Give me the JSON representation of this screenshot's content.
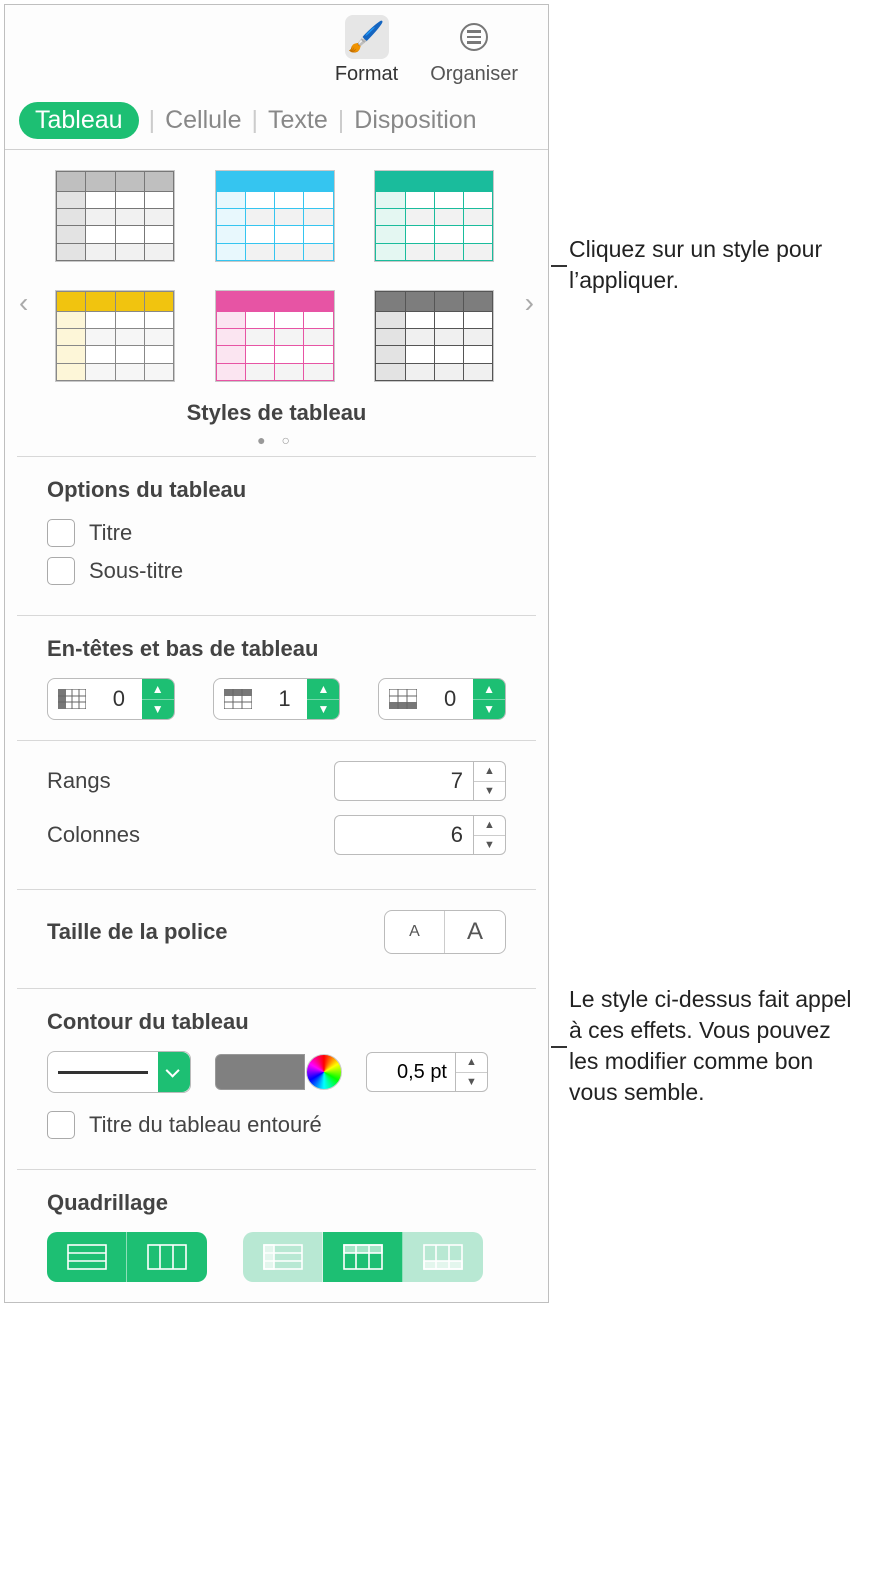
{
  "toolbar": {
    "format": "Format",
    "organize": "Organiser"
  },
  "tabs": {
    "tableau": "Tableau",
    "cellule": "Cellule",
    "texte": "Texte",
    "disposition": "Disposition"
  },
  "styles_title": "Styles de tableau",
  "options": {
    "title": "Options du tableau",
    "titre": "Titre",
    "sous_titre": "Sous-titre"
  },
  "headers": {
    "title": "En-têtes et bas de tableau",
    "cols": "0",
    "rows": "1",
    "footers": "0"
  },
  "size": {
    "rows_label": "Rangs",
    "rows": "7",
    "cols_label": "Colonnes",
    "cols": "6"
  },
  "font": {
    "title": "Taille de la police"
  },
  "outline": {
    "title": "Contour du tableau",
    "width": "0,5 pt",
    "outlined_title": "Titre du tableau entouré"
  },
  "grid": {
    "title": "Quadrillage"
  },
  "callouts": {
    "c1": "Cliquez sur un style pour l’appliquer.",
    "c2": "Le style ci-dessus fait appel à ces effets. Vous pouvez les modifier comme bon vous semble."
  }
}
